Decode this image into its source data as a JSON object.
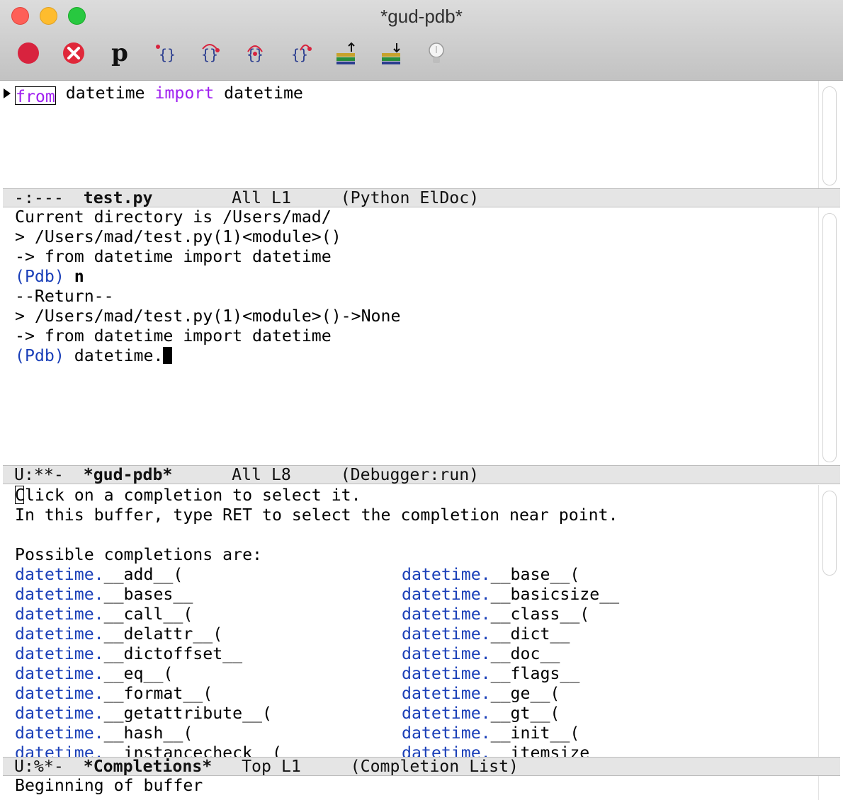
{
  "window": {
    "title": "*gud-pdb*"
  },
  "toolbar": {
    "items": [
      {
        "icon": "stop-icon"
      },
      {
        "icon": "close-icon"
      },
      {
        "icon": "print-p-icon",
        "glyph": "p"
      },
      {
        "icon": "step-icon"
      },
      {
        "icon": "next-icon"
      },
      {
        "icon": "up-icon"
      },
      {
        "icon": "finish-icon"
      },
      {
        "icon": "up-stack-icon"
      },
      {
        "icon": "down-stack-icon"
      },
      {
        "icon": "help-icon"
      }
    ]
  },
  "source": {
    "line1": {
      "kw1": "from",
      "t1": " datetime ",
      "kw2": "import",
      "t2": " datetime"
    },
    "modeline": {
      "flags": "-:---  ",
      "name": "test.py",
      "pos": "        All L1     ",
      "mode": "(Python ElDoc)"
    }
  },
  "gud": {
    "lines": [
      "Current directory is /Users/mad/",
      "> /Users/mad/test.py(1)<module>()",
      "-> from datetime import datetime",
      "",
      "--Return--",
      "> /Users/mad/test.py(1)<module>()->None",
      "-> from datetime import datetime"
    ],
    "prompt": "(Pdb)",
    "cmd1": " n",
    "cmd2": " datetime.",
    "modeline": {
      "flags": "U:**-  ",
      "name": "*gud-pdb*",
      "pos": "      All L8     ",
      "mode": "(Debugger:run)"
    }
  },
  "completions": {
    "help1": "Click on a completion to select it.",
    "help2": "In this buffer, type RET to select the completion near point.",
    "heading": "Possible completions are:",
    "prefix": "datetime.",
    "left": [
      "__add__(",
      "__bases__",
      "__call__(",
      "__delattr__(",
      "__dictoffset__",
      "__eq__(",
      "__format__(",
      "__getattribute__(",
      "__hash__(",
      "__instancecheck__("
    ],
    "right": [
      "__base__(",
      "__basicsize__",
      "__class__(",
      "__dict__",
      "__doc__",
      "__flags__",
      "__ge__(",
      "__gt__(",
      "__init__(",
      "__itemsize__"
    ],
    "modeline": {
      "flags": "U:%*-  ",
      "name": "*Completions*",
      "pos": "   Top L1     ",
      "mode": "(Completion List)"
    }
  },
  "echo": "Beginning of buffer",
  "colors": {
    "keyword": "#a020f0",
    "prompt": "#1a3fb8",
    "modeline_bg": "#e5e5e5"
  }
}
